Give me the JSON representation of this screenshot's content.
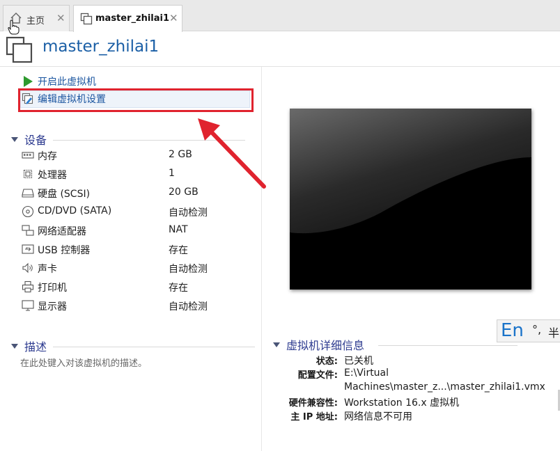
{
  "tabs": [
    {
      "label": "主页",
      "icon": "home-icon",
      "active": false
    },
    {
      "label": "master_zhilai1",
      "icon": "vm-icon",
      "active": true
    }
  ],
  "vm": {
    "title": "master_zhilai1"
  },
  "actions": {
    "start_label": "开启此虚拟机",
    "edit_label": "编辑虚拟机设置"
  },
  "devices": {
    "heading": "设备",
    "items": [
      {
        "name": "内存",
        "value": "2 GB",
        "icon": "memory-icon"
      },
      {
        "name": "处理器",
        "value": "1",
        "icon": "cpu-icon"
      },
      {
        "name": "硬盘 (SCSI)",
        "value": "20 GB",
        "icon": "harddisk-icon"
      },
      {
        "name": "CD/DVD (SATA)",
        "value": "自动检测",
        "icon": "cd-icon"
      },
      {
        "name": "网络适配器",
        "value": "NAT",
        "icon": "network-icon"
      },
      {
        "name": "USB 控制器",
        "value": "存在",
        "icon": "usb-icon"
      },
      {
        "name": "声卡",
        "value": "自动检测",
        "icon": "speaker-icon"
      },
      {
        "name": "打印机",
        "value": "存在",
        "icon": "printer-icon"
      },
      {
        "name": "显示器",
        "value": "自动检测",
        "icon": "monitor-icon"
      }
    ]
  },
  "description": {
    "heading": "描述",
    "placeholder": "在此处键入对该虚拟机的描述。"
  },
  "details": {
    "heading": "虚拟机详细信息",
    "state_label": "状态:",
    "state_value": "已关机",
    "config_label": "配置文件:",
    "config_value_line1": "E:\\Virtual",
    "config_value_line2": "Machines\\master_z...\\master_zhilai1.vmx",
    "compat_label": "硬件兼容性:",
    "compat_value": "Workstation 16.x 虚拟机",
    "ip_label": "主 IP 地址:",
    "ip_value": "网络信息不可用"
  },
  "ime": {
    "mode": "En",
    "punct": "°,",
    "width": "半"
  },
  "colors": {
    "accent": "#1b5fa6",
    "highlight": "#e0232e",
    "section": "#2c3a8f",
    "start_green": "#2e9a2e"
  }
}
